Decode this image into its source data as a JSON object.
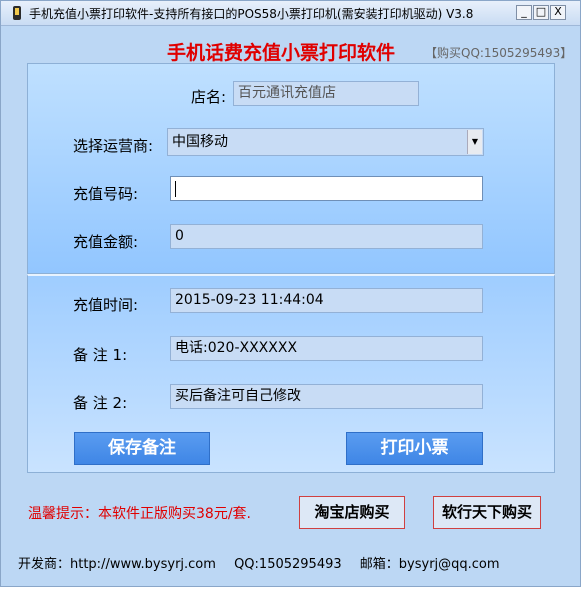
{
  "window": {
    "title": "手机充值小票打印软件-支持所有接口的POS58小票打印机(需安装打印机驱动)  V3.8",
    "buttons": {
      "minimize": "_",
      "maximize": "□",
      "close": "X"
    }
  },
  "header": {
    "banner": "手机话费充值小票打印软件",
    "buy_qq": "【购买QQ:1505295493】"
  },
  "form": {
    "store_label": "店名:",
    "store_value": "百元通讯充值店",
    "carrier_label": "选择运营商:",
    "carrier_value": "中国移动",
    "phone_label": "充值号码:",
    "phone_value": "",
    "amount_label": "充值金额:",
    "amount_value": "0",
    "time_label": "充值时间:",
    "time_value": "2015-09-23 11:44:04",
    "note1_label": "备    注 1:",
    "note1_value": "电话:020-XXXXXX",
    "note2_label": "备    注 2:",
    "note2_value": "买后备注可自己修改"
  },
  "actions": {
    "save_label": "保存备注",
    "print_label": "打印小票"
  },
  "purchase": {
    "warning": "温馨提示：本软件正版购买38元/套.",
    "taobao_label": "淘宝店购买",
    "rxtx_label": "软行天下购买"
  },
  "footer": {
    "developer": "开发商：http://www.bysyrj.com",
    "qq": "QQ:1505295493",
    "email": "邮箱：bysyrj@qq.com"
  }
}
